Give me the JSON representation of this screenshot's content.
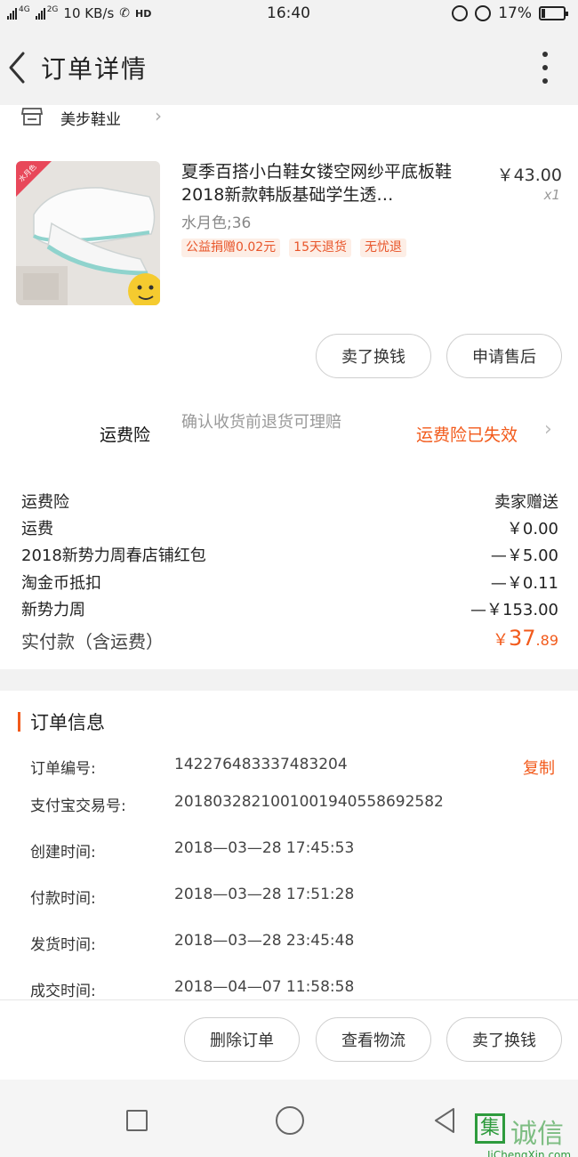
{
  "status_bar": {
    "network": "4G",
    "network2": "2G",
    "speed": "10 KB/s",
    "hd": "HD",
    "time": "16:40",
    "battery": "17%",
    "battery_level": 0.17
  },
  "header": {
    "title": "订单详情"
  },
  "shop": {
    "name": "美步鞋业"
  },
  "product": {
    "title": "夏季百搭小白鞋女镂空网纱平底板鞋2018新款韩版基础学生透…",
    "price": "￥43.00",
    "qty": "x1",
    "sku": "水月色;36",
    "thumb_tag": "水月色",
    "tags": [
      "公益捐赠0.02元",
      "15天退货",
      "无忧退"
    ]
  },
  "actions": {
    "sell_label": "卖了换钱",
    "after_sale_label": "申请售后"
  },
  "insurance": {
    "label": "运费险",
    "desc": "确认收货前退货可理赔",
    "status": "运费险已失效"
  },
  "fees": [
    {
      "label": "运费险",
      "value": "卖家赠送"
    },
    {
      "label": "运费",
      "value": "￥0.00"
    },
    {
      "label": "2018新势力周春店铺红包",
      "value": "—￥5.00"
    },
    {
      "label": "淘金币抵扣",
      "value": "—￥0.11"
    },
    {
      "label": "新势力周",
      "value": "—￥153.00"
    }
  ],
  "total": {
    "label": "实付款（含运费）",
    "symbol": "￥",
    "integer": "37",
    "decimal": ".89"
  },
  "order_info": {
    "title": "订单信息",
    "copy_label": "复制",
    "rows": [
      {
        "label": "订单编号:",
        "value": "142276483337483204"
      },
      {
        "label": "支付宝交易号:",
        "value": "2018032821001001940558692582"
      },
      {
        "label": "创建时间:",
        "value": "2018—03—28  17:45:53"
      },
      {
        "label": "付款时间:",
        "value": "2018—03—28  17:51:28"
      },
      {
        "label": "发货时间:",
        "value": "2018—03—28  23:45:48"
      },
      {
        "label": "成交时间:",
        "value": "2018—04—07  11:58:58"
      }
    ]
  },
  "bottom_actions": {
    "delete_label": "删除订单",
    "logistics_label": "查看物流",
    "sell_label": "卖了换钱"
  },
  "watermark": {
    "cn": "诚信",
    "box": "集",
    "en": "JiChengXin.com"
  }
}
